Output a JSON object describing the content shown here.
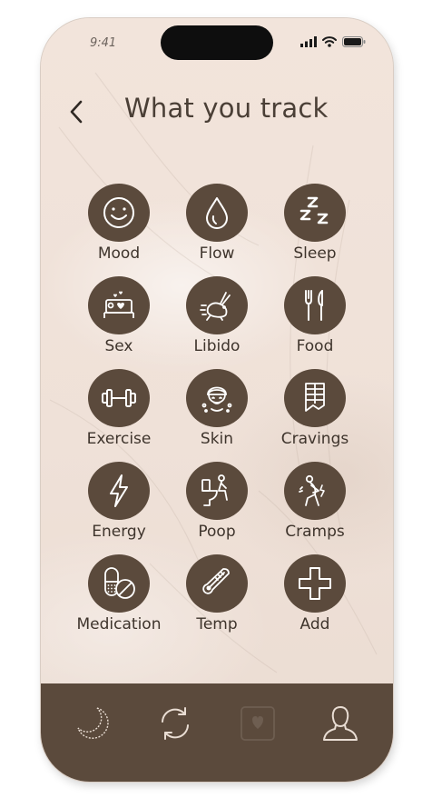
{
  "status": {
    "time": "9:41"
  },
  "header": {
    "title": "What you track"
  },
  "trackers": [
    {
      "label": "Mood",
      "icon": "smiley-icon"
    },
    {
      "label": "Flow",
      "icon": "droplet-icon"
    },
    {
      "label": "Sleep",
      "icon": "zzz-icon"
    },
    {
      "label": "Sex",
      "icon": "bed-hearts-icon"
    },
    {
      "label": "Libido",
      "icon": "rabbit-icon"
    },
    {
      "label": "Food",
      "icon": "fork-knife-icon"
    },
    {
      "label": "Exercise",
      "icon": "dumbbell-icon"
    },
    {
      "label": "Skin",
      "icon": "face-towel-icon"
    },
    {
      "label": "Cravings",
      "icon": "chocolate-bar-icon"
    },
    {
      "label": "Energy",
      "icon": "lightning-icon"
    },
    {
      "label": "Poop",
      "icon": "toilet-person-icon"
    },
    {
      "label": "Cramps",
      "icon": "cramp-person-icon"
    },
    {
      "label": "Medication",
      "icon": "pills-icon"
    },
    {
      "label": "Temp",
      "icon": "thermometer-icon"
    },
    {
      "label": "Add",
      "icon": "plus-icon"
    }
  ],
  "tabbar": {
    "items": [
      {
        "icon": "moon-icon"
      },
      {
        "icon": "cycle-arrows-icon"
      },
      {
        "icon": "heart-square-icon"
      },
      {
        "icon": "user-icon"
      }
    ]
  },
  "colors": {
    "background": "#f3e6dd",
    "accent": "#5b4a3c",
    "text": "#3e342c"
  }
}
